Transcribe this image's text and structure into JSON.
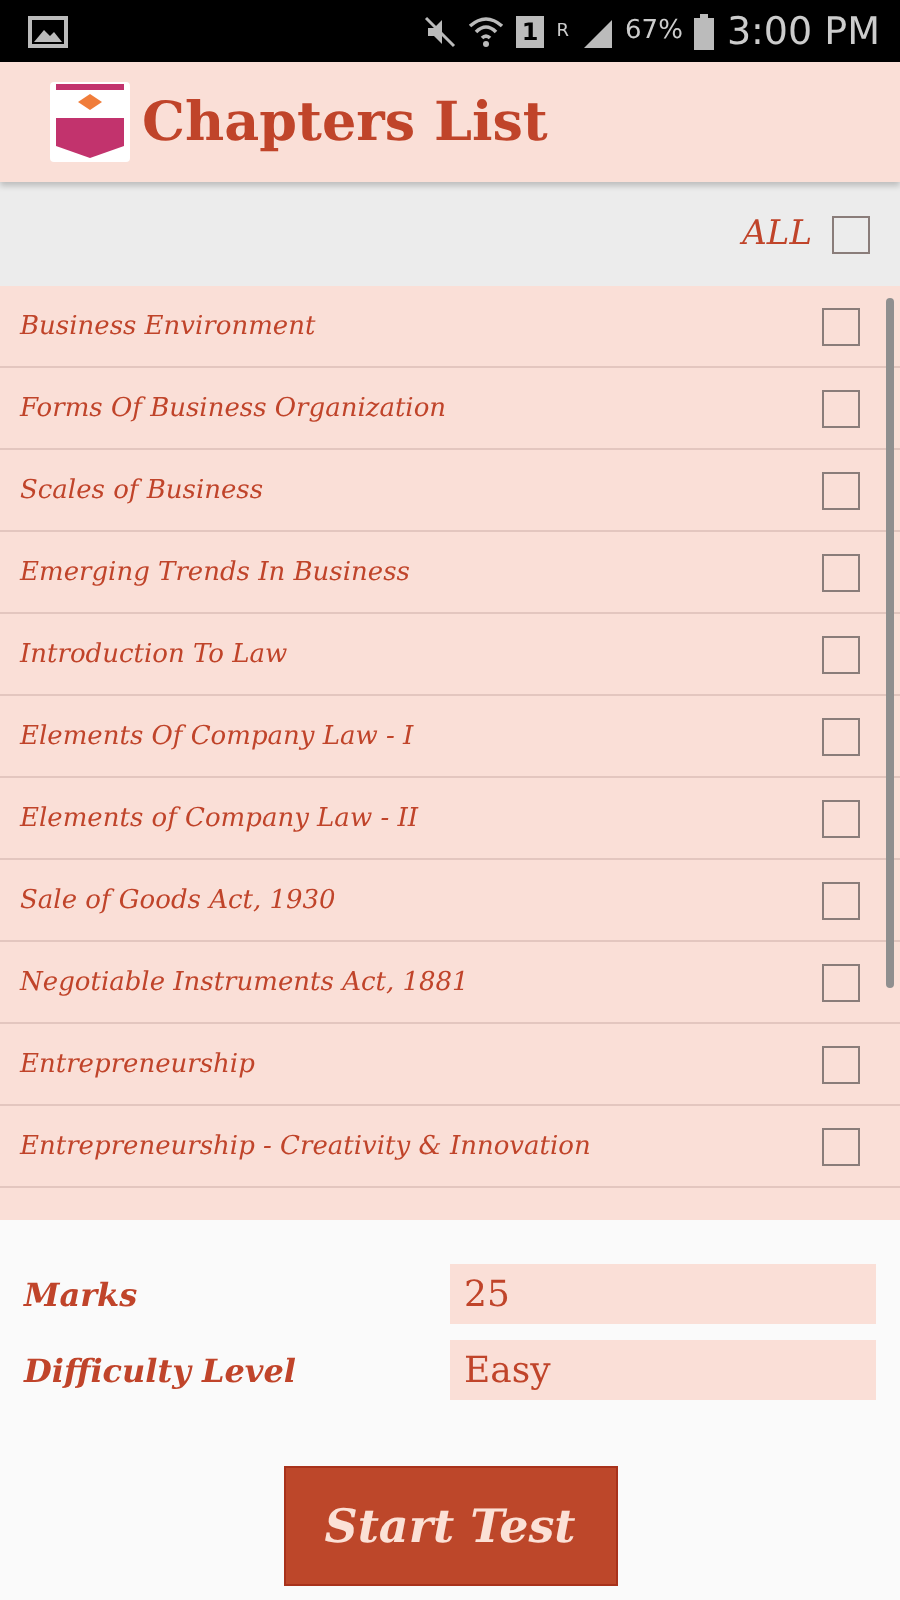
{
  "status_bar": {
    "sim": "1",
    "roaming": "R",
    "battery": "67%",
    "time": "3:00 PM"
  },
  "app_bar": {
    "title": "Chapters List"
  },
  "select_all": {
    "label": "ALL",
    "checked": false
  },
  "chapters": [
    {
      "label": "Business Environment",
      "checked": false
    },
    {
      "label": "Forms Of Business Organization",
      "checked": false
    },
    {
      "label": "Scales of Business",
      "checked": false
    },
    {
      "label": "Emerging Trends In Business",
      "checked": false
    },
    {
      "label": "Introduction To Law",
      "checked": false
    },
    {
      "label": "Elements Of Company Law - I",
      "checked": false
    },
    {
      "label": "Elements of Company Law - II",
      "checked": false
    },
    {
      "label": "Sale of Goods Act, 1930",
      "checked": false
    },
    {
      "label": "Negotiable Instruments Act, 1881",
      "checked": false
    },
    {
      "label": "Entrepreneurship",
      "checked": false
    },
    {
      "label": "Entrepreneurship - Creativity & Innovation",
      "checked": false
    }
  ],
  "settings": [
    {
      "label": "Marks",
      "value": "25"
    },
    {
      "label": "Difficulty Level",
      "value": "Easy"
    }
  ],
  "start_button": "Start Test"
}
